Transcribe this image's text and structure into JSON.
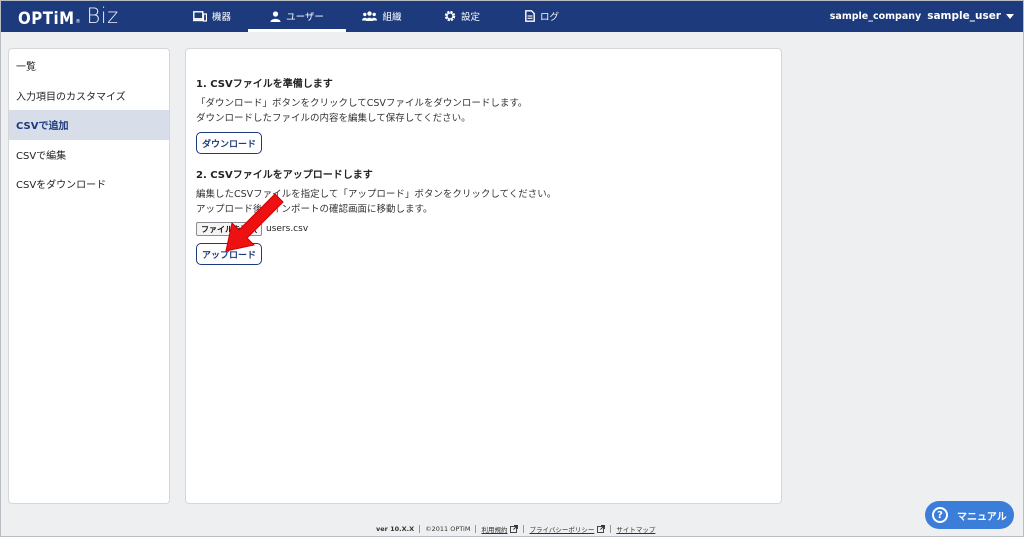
{
  "header": {
    "logo_main": "OPTiM",
    "logo_tm": "®",
    "logo_sub": "Biz",
    "nav": [
      {
        "label": "機器",
        "icon": "device-icon"
      },
      {
        "label": "ユーザー",
        "icon": "user-icon"
      },
      {
        "label": "組織",
        "icon": "group-icon"
      },
      {
        "label": "設定",
        "icon": "gear-icon"
      },
      {
        "label": "ログ",
        "icon": "document-icon"
      }
    ],
    "active_nav": "ユーザー",
    "company": "sample_company",
    "user": "sample_user"
  },
  "sidebar": {
    "items": [
      {
        "label": "一覧"
      },
      {
        "label": "入力項目のカスタマイズ"
      },
      {
        "label": "CSVで追加"
      },
      {
        "label": "CSVで編集"
      },
      {
        "label": "CSVをダウンロード"
      }
    ],
    "active": "CSVで追加"
  },
  "main": {
    "step1": {
      "title": "1. CSVファイルを準備します",
      "desc1": "「ダウンロード」ボタンをクリックしてCSVファイルをダウンロードします。",
      "desc2": "ダウンロードしたファイルの内容を編集して保存してください。",
      "button": "ダウンロード"
    },
    "step2": {
      "title": "2. CSVファイルをアップロードします",
      "desc1": "編集したCSVファイルを指定して「アップロード」ボタンをクリックしてください。",
      "desc2": "アップロード後、インポートの確認画面に移動します。",
      "file_button": "ファイルを選択",
      "file_name": "users.csv",
      "button": "アップロード"
    }
  },
  "footer": {
    "version": "ver 10.X.X",
    "copyright": "©2011 OPTiM",
    "terms": "利用規約",
    "privacy": "プライバシーポリシー",
    "sitemap": "サイトマップ"
  },
  "manual": {
    "label": "マニュアル"
  },
  "colors": {
    "header": "#1d3a7d",
    "accent": "#3b7ed9",
    "arrow": "#ee1111"
  }
}
